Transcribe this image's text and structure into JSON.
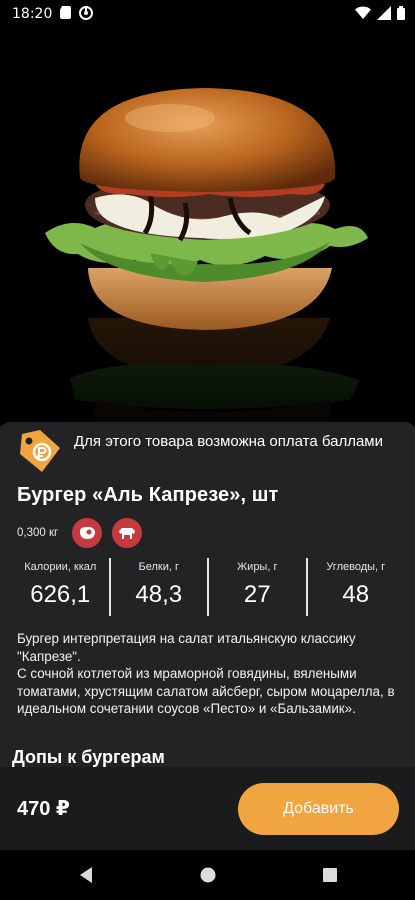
{
  "status_bar": {
    "time": "18:20",
    "icons": [
      "sd-card-icon",
      "vpn-icon",
      "wifi-icon",
      "signal-icon",
      "battery-icon"
    ]
  },
  "product": {
    "image_icon": "burger-photo",
    "points_text": "Для этого товара возможна оплата баллами",
    "title": "Бургер «Аль Капрезе», шт",
    "weight": "0,300 кг",
    "tag_icons": [
      "beef-icon",
      "cow-icon"
    ],
    "nutrition": [
      {
        "label": "Калории, ккал",
        "value": "626,1"
      },
      {
        "label": "Белки, г",
        "value": "48,3"
      },
      {
        "label": "Жиры, г",
        "value": "27"
      },
      {
        "label": "Углеводы, г",
        "value": "48"
      }
    ],
    "description": "Бургер интерпретация на салат итальянскую классику \"Капрезе\".\nС сочной котлетой из мраморной говядины, вялеными томатами, хрустящим салатом айсберг, сыром моцарелла, в идеальном сочетании соусов «Песто» и «Бальзамик».",
    "addons_title": "Допы к бургерам"
  },
  "cart": {
    "price": "470 ₽",
    "add_label": "Добавить"
  },
  "colors": {
    "accent": "#f0a540",
    "tag_red": "#c43a3f",
    "sheet_bg": "#232325",
    "points_badge": "#f0a540"
  }
}
